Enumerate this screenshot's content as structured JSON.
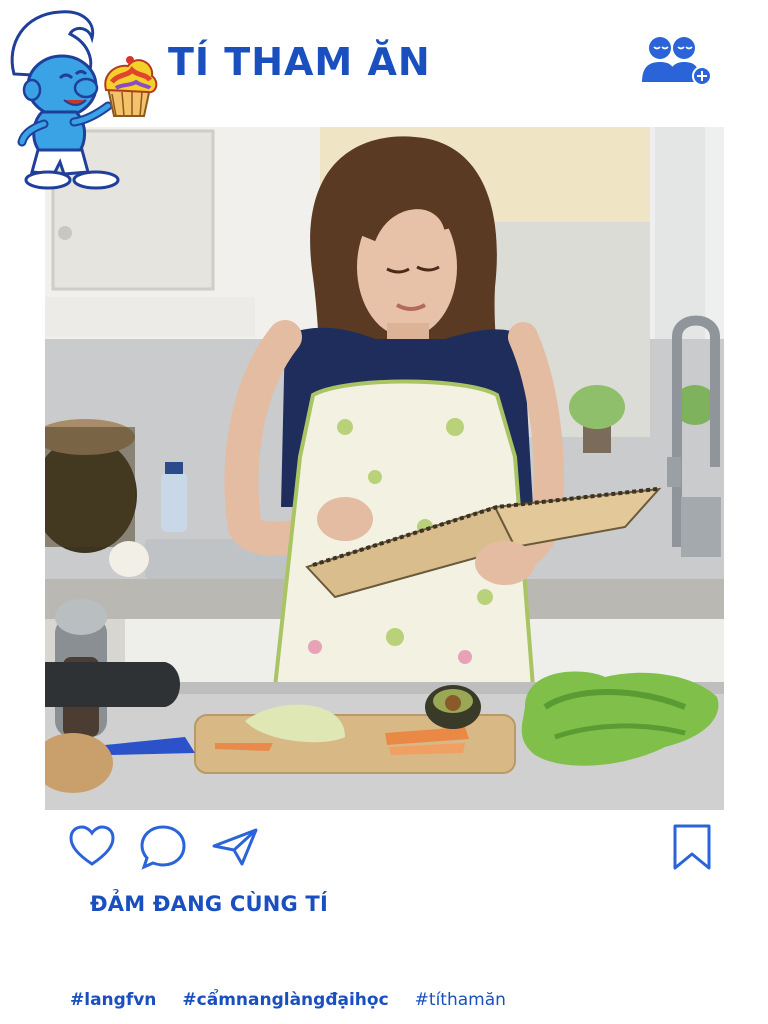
{
  "header": {
    "title": "TÍ THAM ĂN",
    "follow_icon": "add-friends-icon"
  },
  "post": {
    "photo_subject": "woman-reading-recipe-book-in-kitchen",
    "actions": {
      "like_icon": "heart-icon",
      "comment_icon": "comment-bubble-icon",
      "share_icon": "paper-plane-icon",
      "save_icon": "bookmark-icon"
    },
    "caption": "ĐẢM ĐANG CÙNG TÍ",
    "hashtags": [
      "#langfvn",
      "#cẩmnanglàngđạihọc",
      "#títhamăn"
    ]
  },
  "colors": {
    "brand_blue": "#1a4fbf",
    "icon_blue": "#2a64d8",
    "background": "#ffffff"
  }
}
